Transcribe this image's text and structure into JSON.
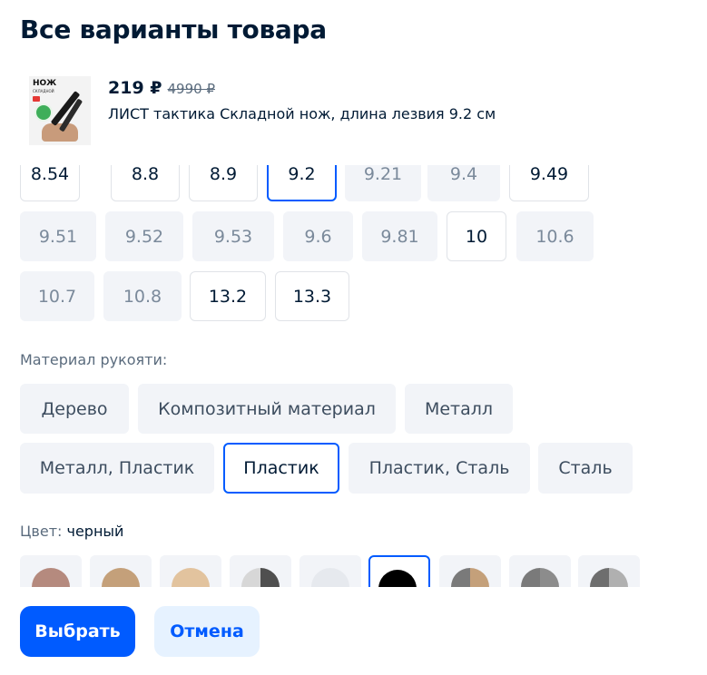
{
  "header": {
    "title": "Все варианты товара"
  },
  "product": {
    "price": "219 ₽",
    "old_price": "4990 ₽",
    "name": "ЛИСТ тактика Складной нож, длина лезвия 9.2 см",
    "thumb_text_main": "НОЖ",
    "thumb_text_sub": "СКЛАДНОЙ"
  },
  "lengths": [
    {
      "label": "8.54",
      "state": "available"
    },
    {
      "label": "8.8",
      "state": "available"
    },
    {
      "label": "8.9",
      "state": "available"
    },
    {
      "label": "9.2",
      "state": "selected"
    },
    {
      "label": "9.21",
      "state": "unavailable"
    },
    {
      "label": "9.4",
      "state": "unavailable"
    },
    {
      "label": "9.49",
      "state": "available"
    },
    {
      "label": "9.51",
      "state": "unavailable"
    },
    {
      "label": "9.52",
      "state": "unavailable"
    },
    {
      "label": "9.53",
      "state": "unavailable"
    },
    {
      "label": "9.6",
      "state": "unavailable"
    },
    {
      "label": "9.81",
      "state": "unavailable"
    },
    {
      "label": "10",
      "state": "available"
    },
    {
      "label": "10.6",
      "state": "unavailable"
    },
    {
      "label": "10.7",
      "state": "unavailable"
    },
    {
      "label": "10.8",
      "state": "unavailable"
    },
    {
      "label": "13.2",
      "state": "available"
    },
    {
      "label": "13.3",
      "state": "available"
    }
  ],
  "material": {
    "label": "Материал рукояти:",
    "options": [
      {
        "label": "Дерево",
        "state": "available"
      },
      {
        "label": "Композитный материал",
        "state": "available"
      },
      {
        "label": "Металл",
        "state": "available"
      },
      {
        "label": "Металл, Пластик",
        "state": "available"
      },
      {
        "label": "Пластик",
        "state": "selected"
      },
      {
        "label": "Пластик, Сталь",
        "state": "available"
      },
      {
        "label": "Сталь",
        "state": "available"
      }
    ]
  },
  "color": {
    "label": "Цвет:",
    "value": "черный",
    "swatches": [
      {
        "colors": [
          "#b58a7e"
        ],
        "state": "available"
      },
      {
        "colors": [
          "#c4a07a"
        ],
        "state": "available"
      },
      {
        "colors": [
          "#e2c39e"
        ],
        "state": "available"
      },
      {
        "colors": [
          "#d7d7d7",
          "#4f4f4f"
        ],
        "state": "available"
      },
      {
        "colors": [
          "#e6e9ee"
        ],
        "state": "available"
      },
      {
        "colors": [
          "#000000"
        ],
        "state": "selected"
      },
      {
        "colors": [
          "#7a7a7a",
          "#c4a07a"
        ],
        "state": "available"
      },
      {
        "colors": [
          "#7a7a7a",
          "#8c8c8c"
        ],
        "state": "available"
      },
      {
        "colors": [
          "#6e6e6e",
          "#b0b0b0"
        ],
        "state": "available"
      }
    ]
  },
  "actions": {
    "select_label": "Выбрать",
    "cancel_label": "Отмена"
  },
  "colors": {
    "accent": "#005bff",
    "accent_light": "#e6f2ff",
    "chip_disabled": "#f2f4f8",
    "text": "#001a34"
  }
}
